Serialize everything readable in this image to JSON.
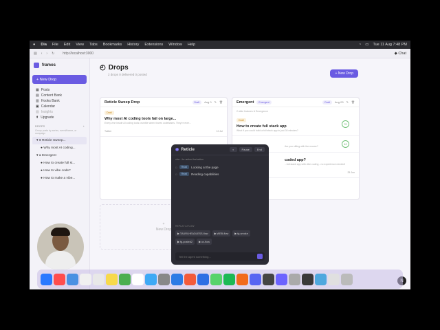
{
  "menubar": {
    "app": "Dia",
    "items": [
      "File",
      "Edit",
      "View",
      "Tabs",
      "Bookmarks",
      "History",
      "Extensions",
      "Window",
      "Help"
    ],
    "clock": "Tue 11 Aug  7:48 PM"
  },
  "browser": {
    "url": "http://localhost:3000",
    "chat_label": "Chat"
  },
  "sidebar": {
    "brand": "framos",
    "new_drop": "New Drop",
    "nav": [
      "Posts",
      "Content Bank",
      "Hooks Bank",
      "Calendar",
      "Insights",
      "Upgrade"
    ],
    "drops_header": "DROPS",
    "drops_sub": "Group posts by series, event/theme, or campaign",
    "tree": [
      {
        "label": "Reticle Sweep...",
        "level": 1,
        "selected": true
      },
      {
        "label": "Why most AI coding...",
        "level": 2
      },
      {
        "label": "Emergent",
        "level": 1
      },
      {
        "label": "How to create full st...",
        "level": 2
      },
      {
        "label": "How to vibe code?",
        "level": 2
      },
      {
        "label": "How to make a vibe...",
        "level": 2
      }
    ]
  },
  "main": {
    "title": "Drops",
    "subtitle": "2 drops  0 delivered  0 posted",
    "new_drop": "+ New Drop",
    "placeholder": "New Drop",
    "columns": [
      {
        "name": "Reticle Sweep Drop",
        "status": "Draft",
        "date": "Aug 0",
        "cards": [
          {
            "tag": "Draft",
            "title": "Why most AI coding tools fail on large...",
            "desc": "Every vine inside AI coding tools crumble when it sees codebases. They're ever...",
            "meta_left": "Twitter",
            "meta_right": "10 Jul"
          }
        ]
      },
      {
        "name": "Emergent",
        "pill": "Emergent",
        "status": "Draft",
        "date": "Aug 03",
        "note": "2 slide features & Emergence",
        "cards": [
          {
            "tag": "Draft",
            "title": "How to create full stack app",
            "desc": "What if you could build a full stack app in just 30 minutes?",
            "score": "70"
          },
          {
            "tag": "",
            "title": "",
            "desc": "Are you sitting with the mouse?",
            "score": "42"
          },
          {
            "tag": "",
            "title": "coded app?",
            "desc": "...full-stack app with vibe coding - no experience needed!",
            "meta_right": "25 Jun"
          }
        ]
      }
    ]
  },
  "overlay": {
    "title": "Reticle",
    "pause": "Pause",
    "end": "End",
    "hint": "vibe · for action that action",
    "steps": [
      {
        "badge": "Read",
        "text": "Looking at the page"
      },
      {
        "badge": "Read",
        "text": "Reading capabilities"
      }
    ],
    "flow_label": "REPLAY A FLOW",
    "flows": [
      "TAURI-HEADLESS-flow",
      "WEB-flow",
      "fg-smoke",
      "fg-posted2",
      "ux-flow"
    ],
    "input_placeholder": "Tell the agent something..."
  },
  "dock": {
    "colors": [
      "#2a79ff",
      "#ff4d4d",
      "#4a90e2",
      "#f0f0f0",
      "#e8e8e8",
      "#f7d94c",
      "#4caf50",
      "#ffffff",
      "#3fa9f5",
      "#888",
      "#2d7be5",
      "#f35b3b",
      "#2f6fe4",
      "#57d36b",
      "#1db954",
      "#f26b1d",
      "#5865f2",
      "#444",
      "#6c63ff",
      "#aaa",
      "#3a3a3a",
      "#4ea8de",
      "#e0e0e0",
      "#bbb"
    ]
  },
  "user_badge": "N"
}
